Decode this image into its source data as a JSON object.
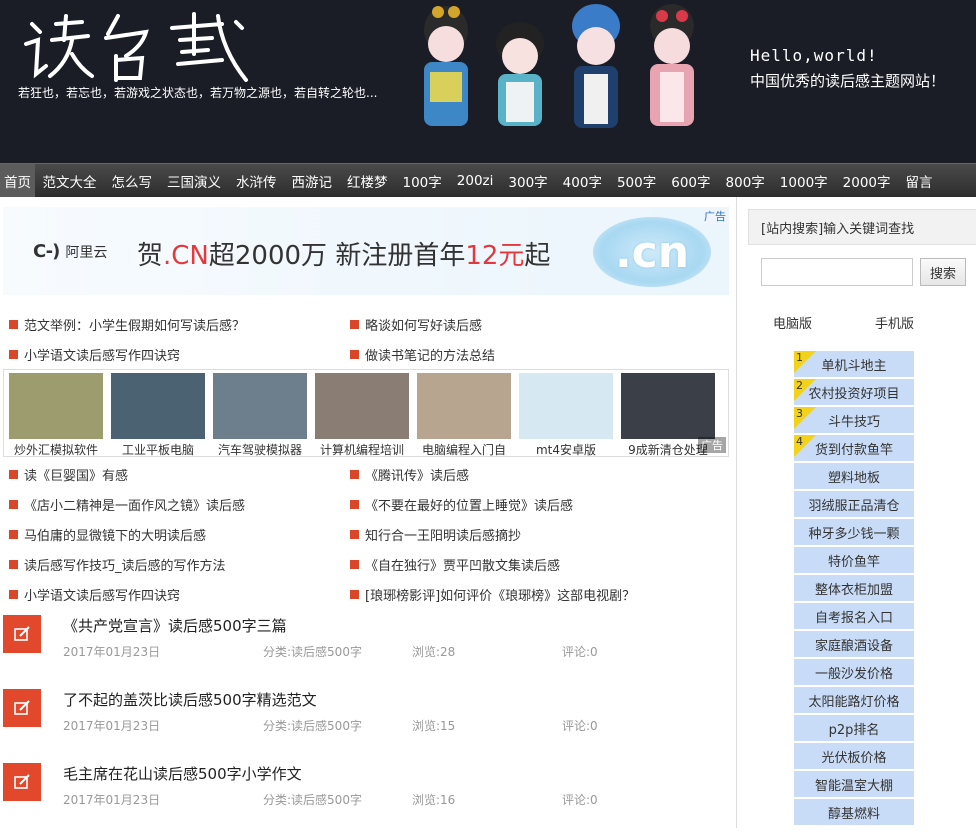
{
  "header": {
    "logo_text": "读后感",
    "slogan": "若狂也，若忘也，若游戏之状态也，若万物之源也，若自转之轮也...",
    "hello": "Hello,world!",
    "tagline": "中国优秀的读后感主题网站！"
  },
  "nav": {
    "items": [
      "首页",
      "范文大全",
      "怎么写",
      "三国演义",
      "水浒传",
      "西游记",
      "红楼梦",
      "100字",
      "200zi",
      "300字",
      "400字",
      "500字",
      "600字",
      "800字",
      "1000字",
      "2000字",
      "留言"
    ]
  },
  "ad_banner": {
    "badge": "广告",
    "brand_logo": "C-)",
    "brand_name": "阿里云",
    "text_1": "贺",
    "text_2": ".CN",
    "text_3": "超2000万  新注册首年",
    "text_4": "12元",
    "text_5": "起",
    "cn_mark": ".cn"
  },
  "links_top": [
    [
      "范文举例：小学生假期如何写读后感？",
      "略谈如何写好读后感"
    ],
    [
      "小学语文读后感写作四诀窍",
      "做读书笔记的方法总结"
    ]
  ],
  "thumbs": {
    "items": [
      "炒外汇模拟软件",
      "工业平板电脑",
      "汽车驾驶模拟器",
      "计算机编程培训",
      "电脑编程入门自",
      "mt4安卓版",
      "9成新清仓处理"
    ],
    "colors": [
      "#9c9c6e",
      "#4b6273",
      "#6d7e8c",
      "#8a7d73",
      "#b7a58f",
      "#d6e9f3",
      "#3b3f47"
    ],
    "ad_mark": "广告"
  },
  "links_bottom": [
    [
      "读《巨婴国》有感",
      "《腾讯传》读后感"
    ],
    [
      "《店小二精神是一面作风之镜》读后感",
      "《不要在最好的位置上睡觉》读后感"
    ],
    [
      "马伯庸的显微镜下的大明读后感",
      "知行合一王阳明读后感摘抄"
    ],
    [
      "读后感写作技巧_读后感的写作方法",
      "《自在独行》贾平凹散文集读后感"
    ],
    [
      "小学语文读后感写作四诀窍",
      "[琅琊榜影评]如何评价《琅琊榜》这部电视剧？"
    ]
  ],
  "articles": [
    {
      "title": "《共产党宣言》读后感500字三篇",
      "date": "2017年01月23日",
      "category": "分类:读后感500字",
      "views": "浏览:28",
      "comments": "评论:0"
    },
    {
      "title": "了不起的盖茨比读后感500字精选范文",
      "date": "2017年01月23日",
      "category": "分类:读后感500字",
      "views": "浏览:15",
      "comments": "评论:0"
    },
    {
      "title": "毛主席在花山读后感500字小学作文",
      "date": "2017年01月23日",
      "category": "分类:读后感500字",
      "views": "浏览:16",
      "comments": "评论:0"
    }
  ],
  "sidebar": {
    "search_title": "[站内搜索]输入关键词查找",
    "search_value": "",
    "search_button": "搜索",
    "pc_version": "电脑版",
    "mobile_version": "手机版",
    "hot_items": [
      {
        "rank": "1",
        "label": "单机斗地主"
      },
      {
        "rank": "2",
        "label": "农村投资好项目"
      },
      {
        "rank": "3",
        "label": "斗牛技巧"
      },
      {
        "rank": "4",
        "label": "货到付款鱼竿"
      },
      {
        "rank": "",
        "label": "塑料地板"
      },
      {
        "rank": "",
        "label": "羽绒服正品清仓"
      },
      {
        "rank": "",
        "label": "种牙多少钱一颗"
      },
      {
        "rank": "",
        "label": "特价鱼竿"
      },
      {
        "rank": "",
        "label": "整体衣柜加盟"
      },
      {
        "rank": "",
        "label": "自考报名入口"
      },
      {
        "rank": "",
        "label": "家庭酿酒设备"
      },
      {
        "rank": "",
        "label": "一般沙发价格"
      },
      {
        "rank": "",
        "label": "太阳能路灯价格"
      },
      {
        "rank": "",
        "label": "p2p排名"
      },
      {
        "rank": "",
        "label": "光伏板价格"
      },
      {
        "rank": "",
        "label": "智能温室大棚"
      },
      {
        "rank": "",
        "label": "醇基燃料"
      }
    ]
  },
  "colors": {
    "header_bg": "#1b1d26",
    "accent_red": "#d9472b",
    "hot_item_bg": "#c9dcf7",
    "rank_badge": "#f3d21a"
  }
}
